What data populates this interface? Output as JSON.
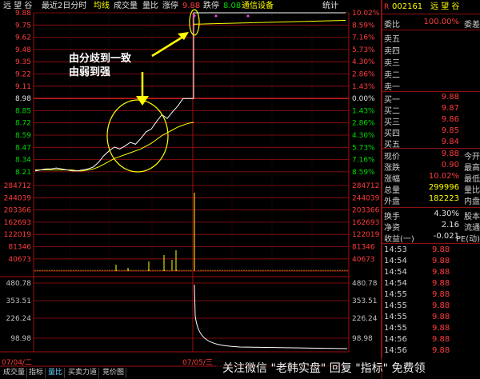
{
  "header": {
    "stock_name": "远 望 谷",
    "period": "最近2日分时",
    "indicators": [
      "均线",
      "成交量",
      "量比"
    ],
    "limit_up_label": "涨停",
    "limit_up_value": "9.88",
    "limit_down_label": "跌停",
    "limit_down_value": "8.08",
    "sector": "通信设备",
    "stats_label": "统计"
  },
  "price_axis": {
    "left_ticks": [
      "9.88",
      "9.75",
      "9.62",
      "9.48",
      "9.35",
      "9.22",
      "9.11",
      "8.98",
      "8.85",
      "8.72",
      "8.59",
      "8.47",
      "8.34",
      "8.21"
    ],
    "right_ticks": [
      "10.02%",
      "8.59%",
      "7.16%",
      "5.73%",
      "4.30%",
      "2.86%",
      "1.43%",
      "0.00%",
      "1.43%",
      "2.86%",
      "4.30%",
      "5.73%",
      "7.16%",
      "8.59%"
    ]
  },
  "volume_axis": {
    "ticks": [
      "284712",
      "244039",
      "203366",
      "162693",
      "122019",
      "81346",
      "40673"
    ]
  },
  "ratio_axis": {
    "ticks": [
      "480.78",
      "353.51",
      "226.24",
      "98.98"
    ]
  },
  "dates": [
    "07/04/二",
    "07/05/三"
  ],
  "bottom_tabs": [
    "成交量",
    "指标",
    "量比",
    "买卖力道",
    "竞价图"
  ],
  "annotation": {
    "line1": "由分歧到一致",
    "line2": "由弱到强"
  },
  "chart_data": {
    "type": "line",
    "title": "",
    "series": [
      {
        "name": "price",
        "values": [
          8.22,
          8.23,
          8.24,
          8.24,
          8.25,
          8.24,
          8.23,
          8.22,
          8.22,
          8.23,
          8.24,
          8.26,
          8.31,
          8.38,
          8.43,
          8.47,
          8.45,
          8.48,
          8.52,
          8.5,
          8.56,
          8.63,
          8.66,
          8.74,
          8.81,
          8.77,
          8.84,
          8.9,
          8.98,
          8.98,
          8.98,
          9.88,
          9.88,
          9.88
        ]
      },
      {
        "name": "avg",
        "values": [
          8.23,
          8.23,
          8.23,
          8.23,
          8.23,
          8.23,
          8.23,
          8.23,
          8.22,
          8.22,
          8.23,
          8.24,
          8.26,
          8.29,
          8.32,
          8.35,
          8.37,
          8.39,
          8.41,
          8.43,
          8.45,
          8.48,
          8.51,
          8.55,
          8.59,
          8.62,
          8.65,
          8.68,
          8.7,
          8.72,
          8.73,
          9.76,
          9.78,
          9.8
        ]
      }
    ],
    "ylim": [
      8.08,
      9.88
    ],
    "prev_close": 8.98
  },
  "quote": {
    "code": "002161",
    "name": "远 望 谷",
    "weibi_label": "委比",
    "weibi": "100.00%",
    "weicha_label": "委差",
    "sell": [
      {
        "label": "卖五",
        "price": ""
      },
      {
        "label": "卖四",
        "price": ""
      },
      {
        "label": "卖三",
        "price": ""
      },
      {
        "label": "卖二",
        "price": ""
      },
      {
        "label": "卖一",
        "price": ""
      }
    ],
    "buy": [
      {
        "label": "买一",
        "price": "9.88"
      },
      {
        "label": "买二",
        "price": "9.87"
      },
      {
        "label": "买三",
        "price": "9.86"
      },
      {
        "label": "买四",
        "price": "9.85"
      },
      {
        "label": "买五",
        "price": "9.84"
      }
    ],
    "stats": [
      {
        "l": "现价",
        "v": "9.88",
        "r": "今开"
      },
      {
        "l": "涨跌",
        "v": "0.90",
        "r": "最高"
      },
      {
        "l": "涨幅",
        "v": "10.02%",
        "r": "最低"
      },
      {
        "l": "总量",
        "v": "299996",
        "r": "量比"
      },
      {
        "l": "外盘",
        "v": "182223",
        "r": "内盘"
      }
    ],
    "stats2": [
      {
        "l": "换手",
        "v": "4.30%",
        "r": "股本"
      },
      {
        "l": "净资",
        "v": "2.16",
        "r": "流通"
      },
      {
        "l": "收益(一)",
        "v": "-0.021",
        "r": "PE(动)"
      }
    ],
    "ticks": [
      {
        "t": "14:53",
        "p": "9.88"
      },
      {
        "t": "14:54",
        "p": "9.88"
      },
      {
        "t": "14:54",
        "p": "9.88"
      },
      {
        "t": "14:54",
        "p": "9.88"
      },
      {
        "t": "14:55",
        "p": "9.88"
      },
      {
        "t": "14:55",
        "p": "9.88"
      },
      {
        "t": "14:55",
        "p": "9.88"
      },
      {
        "t": "14:55",
        "p": "9.88"
      },
      {
        "t": "14:56",
        "p": "9.88"
      },
      {
        "t": "14:56",
        "p": "9.88"
      }
    ]
  },
  "watermark": "关注微信 \"老韩实盘\" 回复 \"指标\" 免费领"
}
